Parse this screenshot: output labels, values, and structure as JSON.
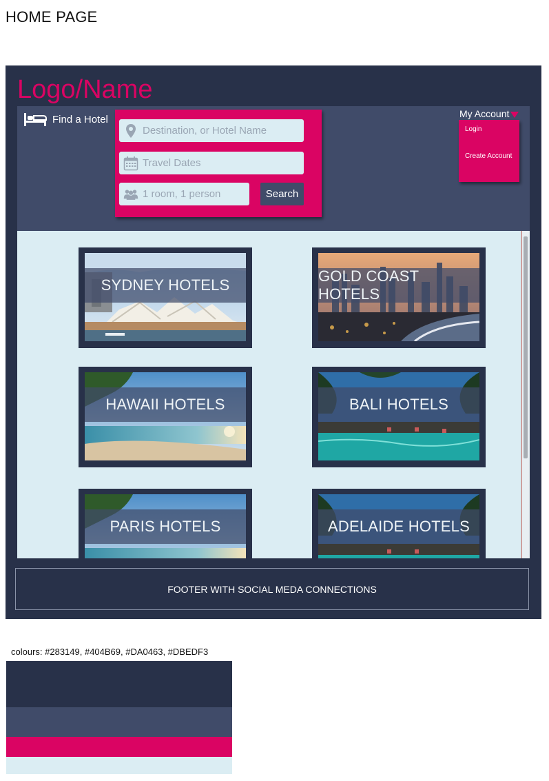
{
  "page_heading": "HOME PAGE",
  "logo": "Logo/Name",
  "search": {
    "find_hotel_label": "Find a Hotel",
    "destination_placeholder": "Destination, or Hotel Name",
    "dates_placeholder": "Travel Dates",
    "guests_placeholder": "1 room, 1 person",
    "search_button": "Search"
  },
  "account": {
    "label": "My Account",
    "menu": [
      "Login",
      "Create Account"
    ]
  },
  "destinations": [
    "SYDNEY HOTELS",
    "GOLD COAST HOTELS",
    "HAWAII HOTELS",
    "BALI HOTELS",
    "PARIS HOTELS",
    "ADELAIDE HOTELS"
  ],
  "footer": "FOOTER WITH SOCIAL MEDA CONNECTIONS",
  "palette": {
    "label": "colours: #283149, #404B69, #DA0463, #DBEDF3",
    "colors": [
      "#283149",
      "#404B69",
      "#DA0463",
      "#DBEDF3"
    ]
  }
}
